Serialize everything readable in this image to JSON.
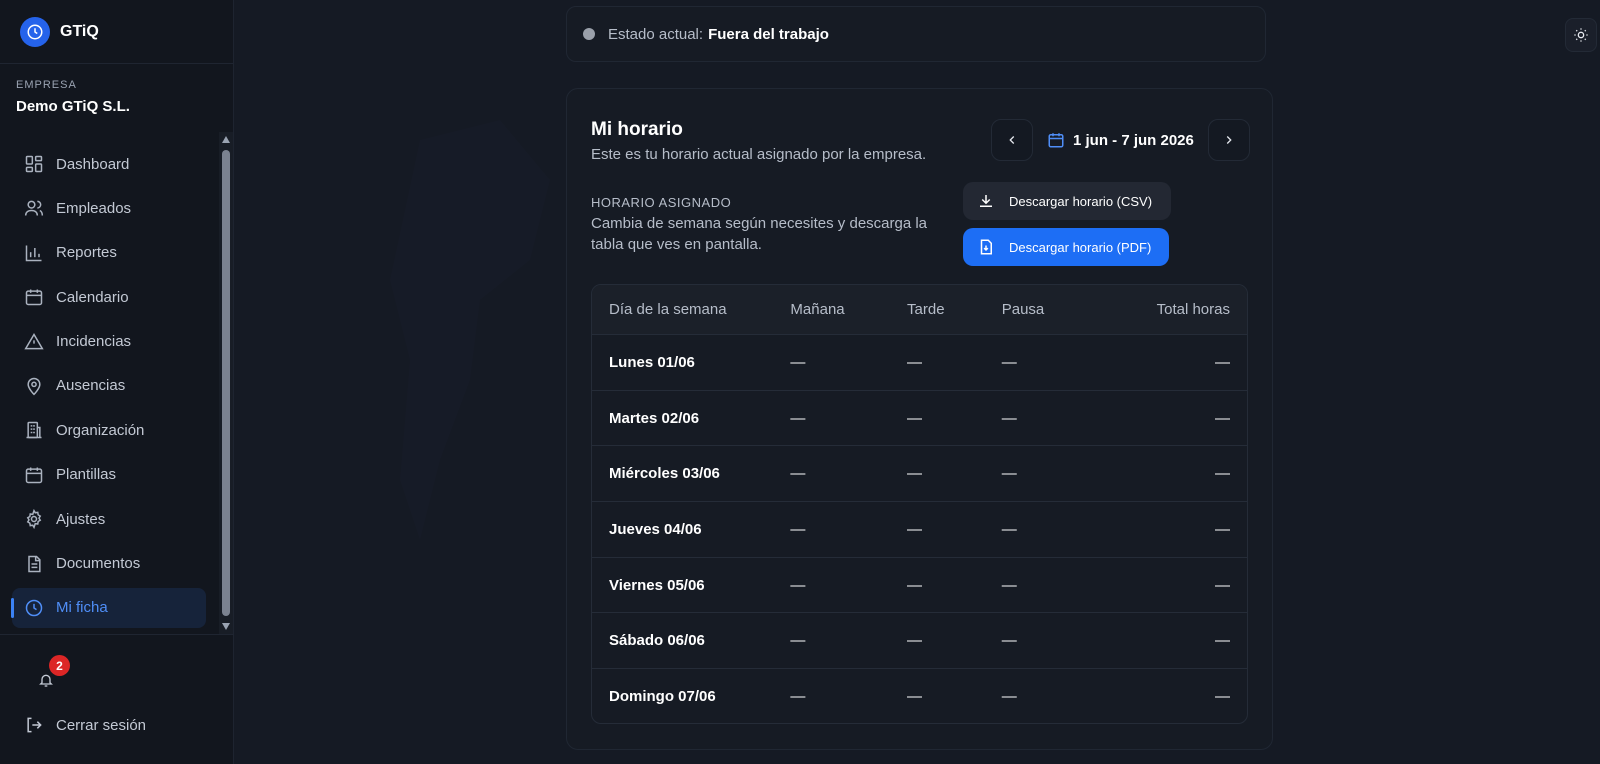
{
  "brand": {
    "name": "GTiQ"
  },
  "company": {
    "label": "EMPRESA",
    "name": "Demo GTiQ S.L."
  },
  "nav": [
    {
      "label": "Dashboard",
      "icon": "dashboard-icon"
    },
    {
      "label": "Empleados",
      "icon": "users-icon"
    },
    {
      "label": "Reportes",
      "icon": "bar-chart-icon"
    },
    {
      "label": "Calendario",
      "icon": "calendar-icon"
    },
    {
      "label": "Incidencias",
      "icon": "warning-icon"
    },
    {
      "label": "Ausencias",
      "icon": "map-pin-icon"
    },
    {
      "label": "Organización",
      "icon": "building-icon"
    },
    {
      "label": "Plantillas",
      "icon": "calendar-icon"
    },
    {
      "label": "Ajustes",
      "icon": "gear-icon"
    },
    {
      "label": "Documentos",
      "icon": "document-icon"
    },
    {
      "label": "Mi ficha",
      "icon": "clock-icon",
      "active": true
    }
  ],
  "notifications": {
    "count": "2"
  },
  "logout": {
    "label": "Cerrar sesión"
  },
  "status": {
    "label": "Estado actual:",
    "value": "Fuera del trabajo"
  },
  "schedule": {
    "title": "Mi horario",
    "subtitle": "Este es tu horario actual asignado por la empresa.",
    "assigned_label": "HORARIO ASIGNADO",
    "assigned_desc": "Cambia de semana según necesites y descarga la tabla que ves en pantalla.",
    "week_range": "1 jun - 7 jun 2026",
    "csv_label": "Descargar horario (CSV)",
    "pdf_label": "Descargar horario (PDF)"
  },
  "table": {
    "headers": [
      "Día de la semana",
      "Mañana",
      "Tarde",
      "Pausa",
      "Total horas"
    ],
    "rows": [
      [
        "Lunes 01/06",
        "—",
        "—",
        "—",
        "—"
      ],
      [
        "Martes 02/06",
        "—",
        "—",
        "—",
        "—"
      ],
      [
        "Miércoles 03/06",
        "—",
        "—",
        "—",
        "—"
      ],
      [
        "Jueves 04/06",
        "—",
        "—",
        "—",
        "—"
      ],
      [
        "Viernes 05/06",
        "—",
        "—",
        "—",
        "—"
      ],
      [
        "Sábado 06/06",
        "—",
        "—",
        "—",
        "—"
      ],
      [
        "Domingo 07/06",
        "—",
        "—",
        "—",
        "—"
      ]
    ]
  },
  "colors": {
    "accent": "#1d6ef5",
    "badge": "#dc2626",
    "background": "#151a24"
  }
}
